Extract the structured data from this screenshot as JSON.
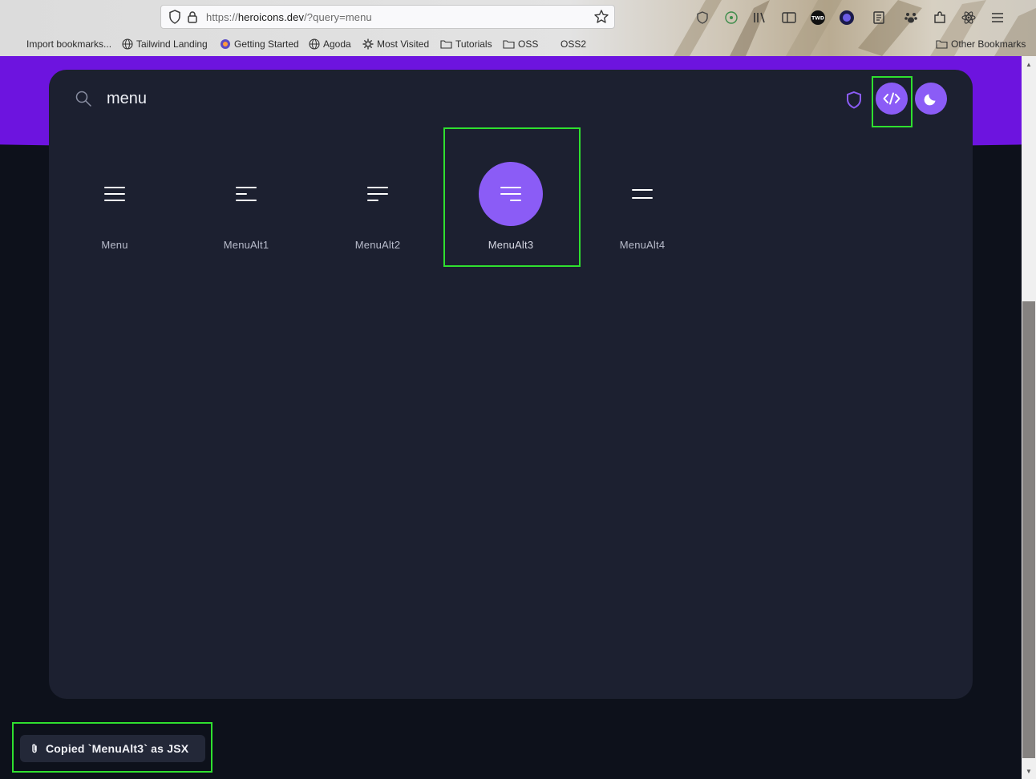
{
  "browser": {
    "url_prefix": "https://",
    "url_host": "heroicons.dev",
    "url_path": "/?query=menu",
    "bookmarks": [
      {
        "label": "Import bookmarks...",
        "icon": "import-icon"
      },
      {
        "label": "Tailwind Landing",
        "icon": "globe-icon"
      },
      {
        "label": "Getting Started",
        "icon": "firefox-icon"
      },
      {
        "label": "Agoda",
        "icon": "globe-icon"
      },
      {
        "label": "Most Visited",
        "icon": "gear-icon"
      },
      {
        "label": "Tutorials",
        "icon": "folder-icon"
      },
      {
        "label": "OSS",
        "icon": "folder-icon"
      },
      {
        "label": "OSS2",
        "icon": "none"
      }
    ],
    "other_bookmarks": "Other Bookmarks",
    "toolbar_badge": "TWD"
  },
  "search": {
    "value": "menu"
  },
  "icons": [
    {
      "label": "Menu"
    },
    {
      "label": "MenuAlt1"
    },
    {
      "label": "MenuAlt2"
    },
    {
      "label": "MenuAlt3"
    },
    {
      "label": "MenuAlt4"
    }
  ],
  "selected_icon": "MenuAlt3",
  "toast": {
    "text": "Copied `MenuAlt3` as JSX"
  },
  "colors": {
    "accent": "#8b5cf6",
    "band": "#6d14df",
    "card": "#1c2030",
    "highlight": "#2fe02f"
  }
}
